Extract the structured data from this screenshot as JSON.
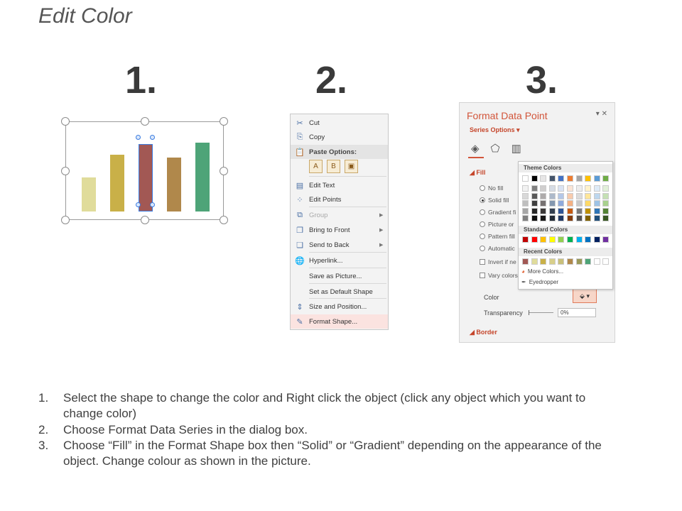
{
  "title": "Edit Color",
  "steps": [
    "1.",
    "2.",
    "3."
  ],
  "chart": {
    "bars": [
      {
        "value": 46,
        "color": "#e0dc9b",
        "selected": false
      },
      {
        "value": 76,
        "color": "#c9b048",
        "selected": false
      },
      {
        "value": 90,
        "color": "#a25854",
        "selected": true
      },
      {
        "value": 72,
        "color": "#b0884b",
        "selected": false
      },
      {
        "value": 92,
        "color": "#4ea478",
        "selected": false
      }
    ]
  },
  "context_menu": {
    "items": [
      {
        "label": "Cut",
        "icon": "cut-icon",
        "glyph": "✂",
        "disabled": false,
        "submenu": false
      },
      {
        "label": "Copy",
        "icon": "copy-icon",
        "glyph": "⎘",
        "disabled": false,
        "submenu": false
      },
      {
        "label": "Paste Options:",
        "icon": "paste-icon",
        "glyph": "📋",
        "disabled": false,
        "submenu": false,
        "header": true
      },
      {
        "label": "Edit Text",
        "icon": "edit-text-icon",
        "glyph": "▤",
        "disabled": false,
        "submenu": false
      },
      {
        "label": "Edit Points",
        "icon": "edit-points-icon",
        "glyph": "⁘",
        "disabled": false,
        "submenu": false
      },
      {
        "label": "Group",
        "icon": "group-icon",
        "glyph": "⧉",
        "disabled": true,
        "submenu": true
      },
      {
        "label": "Bring to Front",
        "icon": "bring-to-front-icon",
        "glyph": "❐",
        "disabled": false,
        "submenu": true
      },
      {
        "label": "Send to Back",
        "icon": "send-to-back-icon",
        "glyph": "❏",
        "disabled": false,
        "submenu": true
      },
      {
        "label": "Hyperlink...",
        "icon": "hyperlink-icon",
        "glyph": "🌐",
        "disabled": false,
        "submenu": false
      },
      {
        "label": "Save as Picture...",
        "icon": "",
        "glyph": "",
        "disabled": false,
        "submenu": false
      },
      {
        "label": "Set as Default Shape",
        "icon": "",
        "glyph": "",
        "disabled": false,
        "submenu": false
      },
      {
        "label": "Size and Position...",
        "icon": "size-position-icon",
        "glyph": "⇕",
        "disabled": false,
        "submenu": false
      },
      {
        "label": "Format Shape...",
        "icon": "format-shape-icon",
        "glyph": "✎",
        "disabled": false,
        "submenu": false,
        "highlight": true
      }
    ],
    "paste_icons": [
      "paste-keep-formatting-icon",
      "paste-merge-formatting-icon",
      "paste-picture-icon"
    ]
  },
  "format_pane": {
    "title": "Format Data Point",
    "series_options": "Series Options",
    "fill_section": "Fill",
    "options": [
      {
        "label": "No fill",
        "type": "radio",
        "checked": false
      },
      {
        "label": "Solid fill",
        "type": "radio",
        "checked": true
      },
      {
        "label": "Gradient fi",
        "type": "radio",
        "checked": false
      },
      {
        "label": "Picture or",
        "type": "radio",
        "checked": false
      },
      {
        "label": "Pattern fill",
        "type": "radio",
        "checked": false
      },
      {
        "label": "Automatic",
        "type": "radio",
        "checked": false
      },
      {
        "label": "Invert if ne",
        "type": "check",
        "checked": false
      },
      {
        "label": "Vary colors",
        "type": "check",
        "checked": false
      }
    ],
    "color_label": "Color",
    "transparency_label": "Transparency",
    "transparency_value": "0%",
    "border_section": "Border"
  },
  "palette": {
    "theme_header": "Theme Colors",
    "standard_header": "Standard Colors",
    "recent_header": "Recent Colors",
    "more_colors": "More Colors...",
    "eyedropper": "Eyedropper",
    "theme_top": [
      "#ffffff",
      "#000000",
      "#e7e6e6",
      "#44546a",
      "#4472c4",
      "#ed7d31",
      "#a5a5a5",
      "#ffc000",
      "#5b9bd5",
      "#70ad47"
    ],
    "theme_shades": [
      [
        "#f2f2f2",
        "#808080",
        "#d0cece",
        "#d6dce5",
        "#dae3f3",
        "#fbe5d6",
        "#ededed",
        "#fff2cc",
        "#deebf7",
        "#e2f0d9"
      ],
      [
        "#d9d9d9",
        "#595959",
        "#aeabab",
        "#adb9ca",
        "#b4c7e7",
        "#f8cbad",
        "#dbdbdb",
        "#ffe699",
        "#bdd7ee",
        "#c5e0b4"
      ],
      [
        "#bfbfbf",
        "#404040",
        "#767171",
        "#8497b0",
        "#8faadc",
        "#f4b183",
        "#c9c9c9",
        "#ffd966",
        "#9dc3e6",
        "#a9d18e"
      ],
      [
        "#a6a6a6",
        "#262626",
        "#3b3838",
        "#333f50",
        "#2f5597",
        "#c55a11",
        "#7b7b7b",
        "#bf9000",
        "#2e75b6",
        "#548235"
      ],
      [
        "#808080",
        "#0d0d0d",
        "#171616",
        "#222a35",
        "#203864",
        "#843c0c",
        "#525252",
        "#806000",
        "#1f4e79",
        "#385723"
      ]
    ],
    "standard": [
      "#c00000",
      "#ff0000",
      "#ffc000",
      "#ffff00",
      "#92d050",
      "#00b050",
      "#00b0f0",
      "#0070c0",
      "#002060",
      "#7030a0"
    ],
    "recent": [
      "#a25854",
      "#e0dc9b",
      "#c9b048",
      "#d8cf8a",
      "#c9c07a",
      "#b0884b",
      "#9a9a5a",
      "#4ea478",
      "#ffffff",
      "#ffffff"
    ]
  },
  "instructions": [
    {
      "n": "1.",
      "text": "Select the shape to change the color and Right click the object (click any object which you want to change color)"
    },
    {
      "n": "2.",
      "text": "Choose Format Data Series in the dialog box."
    },
    {
      "n": "3.",
      "text": "Choose “Fill” in the Format Shape box then “Solid” or “Gradient” depending on the appearance of the object. Change colour as shown in the picture."
    }
  ]
}
